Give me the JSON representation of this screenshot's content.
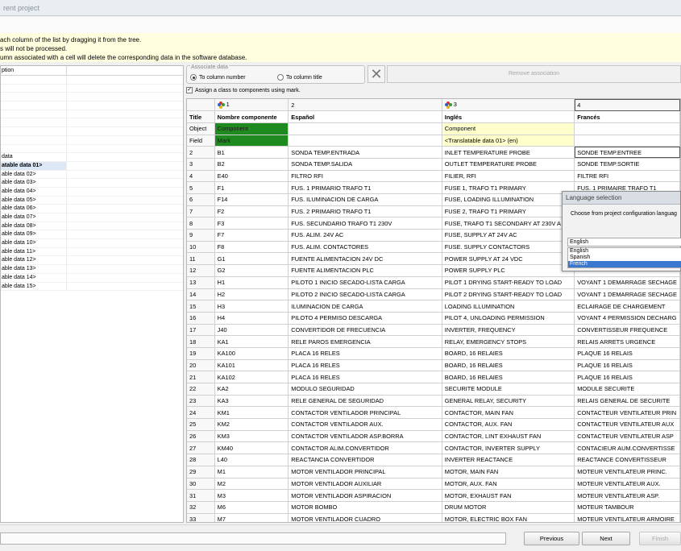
{
  "window": {
    "title": "rent project"
  },
  "info": {
    "lines": [
      "ach column of the list by dragging it from the tree.",
      "s will not be processed.",
      "umn associated with a cell will delete the corresponding data in the software database."
    ]
  },
  "left_panel": {
    "header": "ption",
    "items": [
      "",
      "",
      "",
      "",
      "",
      "",
      "",
      "",
      "",
      "data",
      "atable data 01>",
      "able data 02>",
      "able data 03>",
      "able data 04>",
      "able data 05>",
      "able data 06>",
      "able data 07>",
      "able data 08>",
      "able data 09>",
      "able data 10>",
      "able data 11>",
      "able data 12>",
      "able data 13>",
      "able data 14>",
      "able data 15>"
    ],
    "selected_index": 10
  },
  "associate": {
    "legend": "Associate data",
    "radio_number": "To column number",
    "radio_title": "To column title",
    "selected": "number",
    "remove_label": "Remove association",
    "checkbox_label": "Assign a class to components using mark.",
    "checkbox_checked": true
  },
  "grid": {
    "col_numbers": [
      "",
      "1",
      "2",
      "3",
      "4"
    ],
    "title_row": [
      "Title",
      "Nombre componente",
      "Español",
      "Inglés",
      "Francés"
    ],
    "object_row": [
      "Object",
      "Component",
      "",
      "Component",
      ""
    ],
    "field_row": [
      "Field",
      "Mark",
      "",
      "<Translatable data 01> (en)",
      ""
    ],
    "rows": [
      [
        "2",
        "B1",
        "SONDA TEMP.ENTRADA",
        "INLET TEMPERATURE PROBE",
        "SONDE TEMP.ENTREE"
      ],
      [
        "3",
        "B2",
        "SONDA TEMP.SALIDA",
        "OUTLET TEMPERATURE PROBE",
        "SONDE TEMP.SORTIE"
      ],
      [
        "4",
        "E40",
        "FILTRO RFI",
        "FILIER, RFI",
        "FILTRE RFI"
      ],
      [
        "5",
        "F1",
        "FUS. 1 PRIMARIO TRAFO T1",
        "FUSE 1, TRAFO T1 PRIMARY",
        "FUS. 1 PRIMAIRE TRAFO T1"
      ],
      [
        "6",
        "F14",
        "FUS. ILUMINACION DE CARGA",
        "FUSE, LOADING ILLUMINATION",
        ""
      ],
      [
        "7",
        "F2",
        "FUS. 2 PRIMARIO TRAFO T1",
        "FUSE 2, TRAFO T1 PRIMARY",
        ""
      ],
      [
        "8",
        "F3",
        "FUS. SECUNDARIO TRAFO T1 230V",
        "FUSE, TRAFO T1 SECONDARY AT 230V A",
        ""
      ],
      [
        "9",
        "F7",
        "FUS. ALIM. 24V AC",
        "FUSE, SUPPLY AT 24V AC",
        ""
      ],
      [
        "10",
        "F8",
        "FUS. ALIM. CONTACTORES",
        "FUSE. SUPPLY CONTACTORS",
        ""
      ],
      [
        "11",
        "G1",
        "FUENTE ALIMENTACION 24V DC",
        "POWER SUPPLY AT 24 VDC",
        ""
      ],
      [
        "12",
        "G2",
        "FUENTE ALIMENTACION PLC",
        "POWER SUPPLY PLC",
        ""
      ],
      [
        "13",
        "H1",
        "PILOTO 1 INICIO SECADO-LISTA CARGA",
        "PILOT 1 DRYING START-READY TO LOAD",
        "VOYANT 1 DEMARRAGE SECHAGE"
      ],
      [
        "14",
        "H2",
        "PILOTO 2 INICIO SECADO-LISTA CARGA",
        "PILOT 2 DRYING START-READY TO LOAD",
        "VOYANT 1 DEMARRAGE SECHAGE"
      ],
      [
        "15",
        "H3",
        "ILUMINACION DE CARGA",
        "LOADING ILLUMINATION",
        "ECLAIRAGE DE CHARGEMENT"
      ],
      [
        "16",
        "H4",
        "PILOTO 4 PERMISO DESCARGA",
        "PILOT 4, UNLOADING PERMISSION",
        "VOYANT 4 PERMISSION DECHARG"
      ],
      [
        "17",
        "J40",
        "CONVERTIDOR DE FRECUENCIA",
        "INVERTER, FREQUENCY",
        "CONVERTISSEUR FREQUENCE"
      ],
      [
        "18",
        "KA1",
        "RELE PAROS EMERGENCIA",
        "RELAY, EMERGENCY STOPS",
        "RELAIS ARRETS URGENCE"
      ],
      [
        "19",
        "KA100",
        "PLACA 16 RELES",
        "BOARD, 16 RELAIES",
        "PLAQUE 16 RELAIS"
      ],
      [
        "20",
        "KA101",
        "PLACA 16 RELES",
        "BOARD, 16 RELAIES",
        "PLAQUE 16 RELAIS"
      ],
      [
        "21",
        "KA102",
        "PLACA 16 RELES",
        "BOARD, 16 RELAIES",
        "PLAQUE 16 RELAIS"
      ],
      [
        "22",
        "KA2",
        "MODULO SEGURIDAD",
        "SECURITE MODULE",
        "MODULE SECURITE"
      ],
      [
        "23",
        "KA3",
        "RELE GENERAL DE SEGURIDAD",
        "GENERAL RELAY, SECURITY",
        "RELAIS GENERAL DE SECURITE"
      ],
      [
        "24",
        "KM1",
        "CONTACTOR VENTILADOR PRINCIPAL",
        "CONTACTOR, MAIN FAN",
        "CONTACTEUR VENTILATEUR PRIN"
      ],
      [
        "25",
        "KM2",
        "CONTACTOR VENTILADOR AUX.",
        "CONTACTOR, AUX. FAN",
        "CONTACTEUR VENTILATEUR AUX"
      ],
      [
        "26",
        "KM3",
        "CONTACTOR VENTILADOR ASP.BORRA",
        "CONTACTOR, LINT EXHAUST FAN",
        "CONTACTEUR VENTILATEUR ASP"
      ],
      [
        "27",
        "KM40",
        "CONTACTOR ALIM.CONVERTIDOR",
        "CONTACTOR, INVERTER SUPPLY",
        "CONTACIEUR AUM.CONVERTISSE"
      ],
      [
        "28",
        "L40",
        "REACTANCIA CONVERTIDOR",
        "INVERTER REACTANCE",
        "REACTANCE CONVERTISSEUR"
      ],
      [
        "29",
        "M1",
        "MOTOR VENTILADOR PRINCIPAL",
        "MOTOR, MAIN FAN",
        "MOTEUR VENTILATEUR PRINC."
      ],
      [
        "30",
        "M2",
        "MOTOR VENTILADOR AUXILIAR",
        "MOTOR, AUX. FAN",
        "MOTEUR VENTILATEUR AUX."
      ],
      [
        "31",
        "M3",
        "MOTOR VENTILADOR ASPIRACION",
        "MOTOR, EXHAUST FAN",
        "MOTEUR VENTILATEUR ASP."
      ],
      [
        "32",
        "M6",
        "MOTOR BOMBO",
        "DRUM MOTOR",
        "MOTEUR TAMBOUR"
      ],
      [
        "33",
        "M7",
        "MOTOR VENTILADOR CUADRO",
        "MOTOR, ELECTRIC BOX FAN",
        "MOTEUR VENTILATEUR ARMOIRE"
      ]
    ]
  },
  "language_popup": {
    "title": "Language selection",
    "message": "Choose from project configuration languag",
    "input_value": "English",
    "options": [
      "English",
      "Spanish",
      "French"
    ],
    "selected": "French"
  },
  "nav": {
    "previous": "Previous",
    "next": "Next",
    "finish": "Finish"
  },
  "colors": {
    "green": "#1f8a1f",
    "yellow": "#ffffcc",
    "info_bg": "#ffffe0",
    "selection": "#3a78d0"
  }
}
